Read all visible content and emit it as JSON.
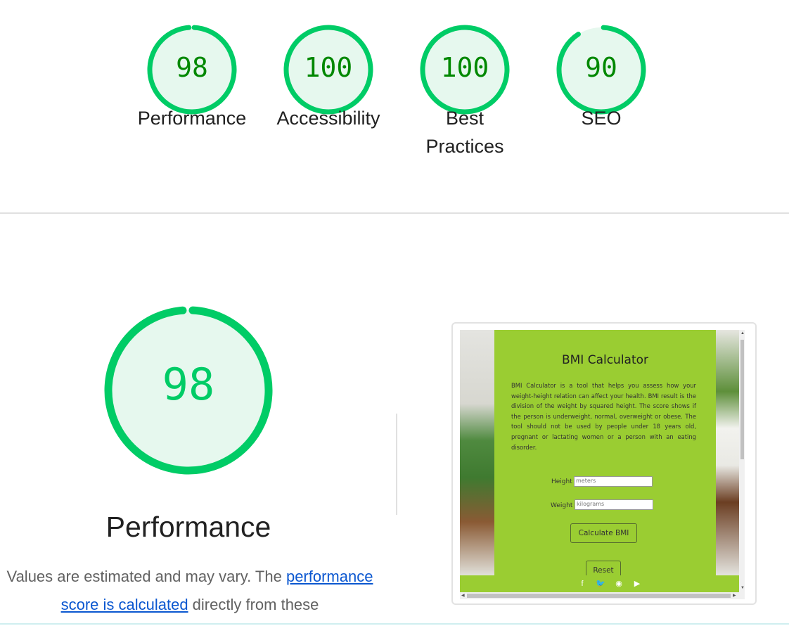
{
  "summary_gauges": [
    {
      "score": "98",
      "label": "Performance",
      "fraction": 0.98
    },
    {
      "score": "100",
      "label": "Accessibility",
      "fraction": 1.0
    },
    {
      "score": "100",
      "label": "Best Practices",
      "fraction": 1.0
    },
    {
      "score": "90",
      "label": "SEO",
      "fraction": 0.9
    }
  ],
  "colors": {
    "pass": "#00cc66",
    "pass_bg": "#e6f8ee",
    "score_text": "#008800",
    "link": "#0b57d0"
  },
  "performance": {
    "score": "98",
    "fraction": 0.98,
    "title": "Performance",
    "desc_prefix": "Values are estimated and may vary. The ",
    "desc_link": "performance score is calculated",
    "desc_suffix": " directly from these"
  },
  "screenshot": {
    "title": "BMI Calculator",
    "description": "BMI Calculator is a tool that helps you assess how your weight-height relation can affect your health. BMI result is the division of the weight by squared height. The score shows if the person is underweight, normal, overweight or obese. The tool should not be used by people under 18 years old, pregnant or lactating women or a person with an eating disorder.",
    "height_label": "Height",
    "height_placeholder": "meters",
    "weight_label": "Weight",
    "weight_placeholder": "kilograms",
    "calculate_button": "Calculate BMI",
    "reset_button": "Reset",
    "social_icons": [
      "facebook-icon",
      "twitter-icon",
      "instagram-icon",
      "youtube-icon"
    ]
  }
}
